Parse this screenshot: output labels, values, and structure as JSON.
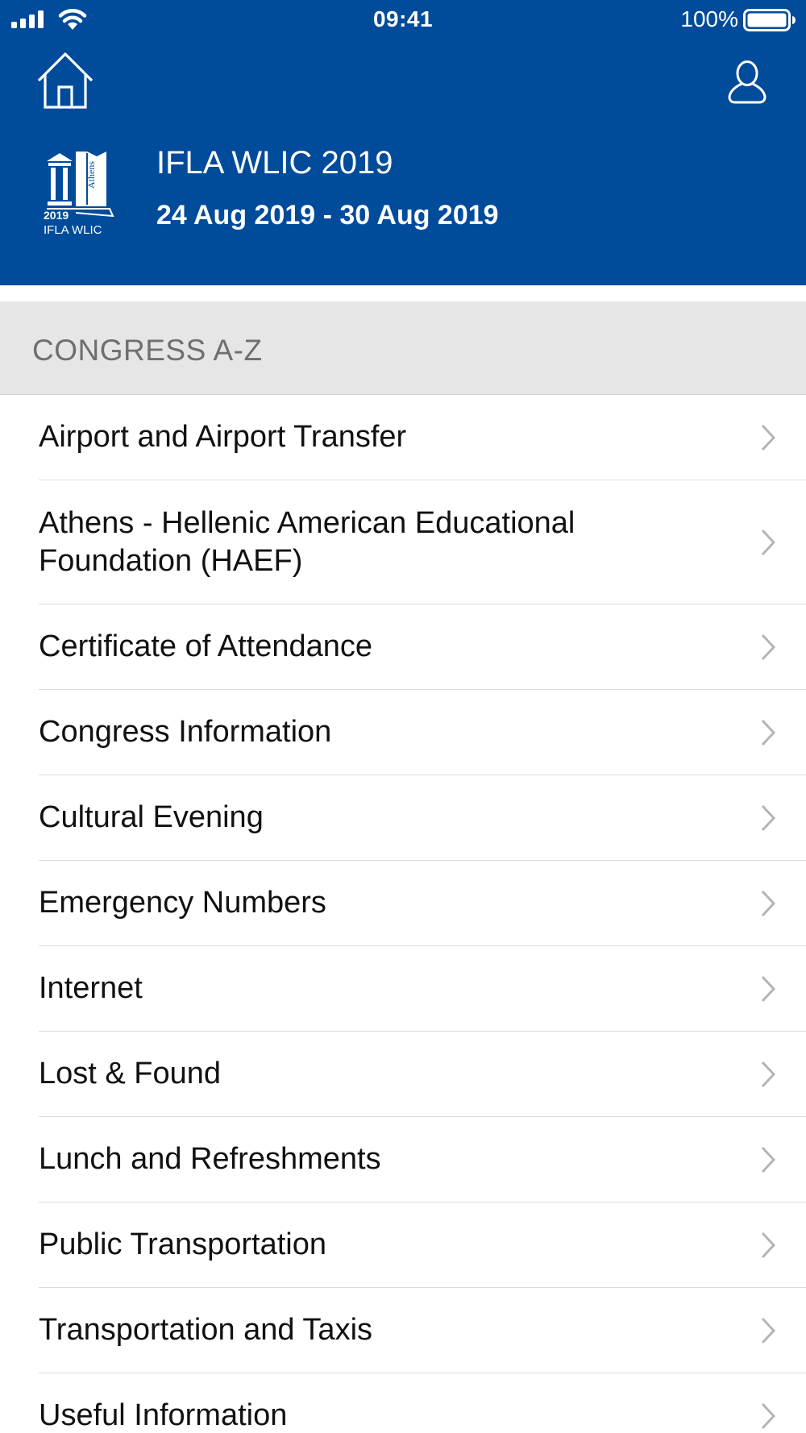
{
  "status_bar": {
    "time": "09:41",
    "battery_percent": "100%",
    "signal_icon": "cellular-signal-icon",
    "wifi_icon": "wifi-icon",
    "battery_icon": "battery-icon"
  },
  "nav": {
    "home_icon": "home-icon",
    "profile_icon": "user-profile-icon"
  },
  "event": {
    "logo_icon": "ifla-wlic-2019-logo",
    "logo_text": [
      "Athens",
      "2019",
      "IFLA WLIC"
    ],
    "title": "IFLA WLIC 2019",
    "dates": "24 Aug 2019 - 30 Aug 2019"
  },
  "section": {
    "title": "CONGRESS A-Z"
  },
  "items": [
    {
      "label": "Airport and Airport Transfer"
    },
    {
      "label": "Athens - Hellenic American Educational Foundation (HAEF)"
    },
    {
      "label": "Certificate of Attendance"
    },
    {
      "label": "Congress Information"
    },
    {
      "label": "Cultural Evening"
    },
    {
      "label": "Emergency Numbers"
    },
    {
      "label": "Internet"
    },
    {
      "label": "Lost & Found"
    },
    {
      "label": "Lunch and Refreshments"
    },
    {
      "label": "Public Transportation"
    },
    {
      "label": "Transportation and Taxis"
    },
    {
      "label": "Useful Information"
    }
  ],
  "colors": {
    "header_background": "#004b9a",
    "section_background": "#e6e6e6",
    "chevron": "#b4b4b4"
  }
}
